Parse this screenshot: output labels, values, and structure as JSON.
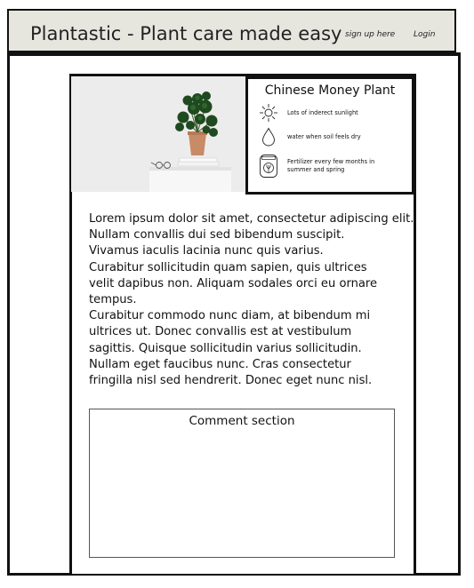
{
  "header": {
    "title": "Plantastic - Plant care made easy",
    "signup_label": "sign up here",
    "login_label": "Login"
  },
  "plant": {
    "name": "Chinese Money Plant",
    "care": [
      {
        "icon": "sun-icon",
        "text": "Lots of inderect sunlight"
      },
      {
        "icon": "water-drop-icon",
        "text": "water when soil feels dry"
      },
      {
        "icon": "fertilizer-bag-icon",
        "text": "Fertilizer every few months in\nsummer and spring"
      }
    ]
  },
  "body": {
    "text": "Lorem ipsum dolor sit amet, consectetur adipiscing elit.\n Nullam convallis dui sed bibendum suscipit.\nVivamus iaculis lacinia nunc quis varius.\nCurabitur sollicitudin quam sapien, quis ultrices\nvelit dapibus non. Aliquam sodales orci eu ornare\ntempus.\n Curabitur commodo nunc diam, at bibendum mi\nultrices ut. Donec convallis est at vestibulum\nsagittis. Quisque sollicitudin varius sollicitudin.\nNullam eget faucibus nunc. Cras consectetur\nfringilla nisl sed hendrerit. Donec eget nunc nisl."
  },
  "comments": {
    "title": "Comment section"
  },
  "colors": {
    "header_bg": "#e6e6df",
    "frame": "#111111"
  }
}
